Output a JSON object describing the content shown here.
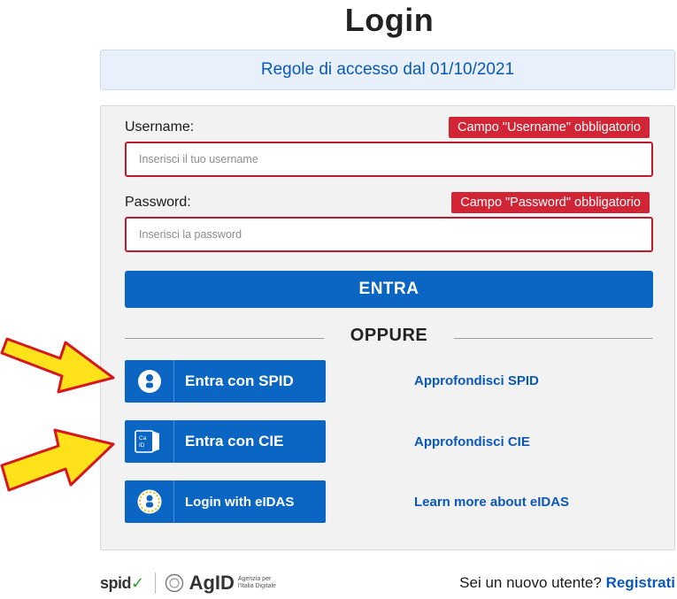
{
  "page": {
    "title": "Login"
  },
  "notice": {
    "text": "Regole di accesso dal 01/10/2021"
  },
  "form": {
    "username": {
      "label": "Username:",
      "error": "Campo \"Username\" obbligatorio",
      "placeholder": "Inserisci il tuo username",
      "value": ""
    },
    "password": {
      "label": "Password:",
      "error": "Campo \"Password\" obbligatorio",
      "placeholder": "Inserisci la password",
      "value": ""
    },
    "submit_label": "ENTRA",
    "divider_text": "OPPURE"
  },
  "auth_options": [
    {
      "label": "Entra con SPID",
      "icon": "user-circle-icon",
      "link": "Approfondisci SPID"
    },
    {
      "label": "Entra con CIE",
      "icon": "cie-card-icon",
      "cie_icon_text": "Ca\nID",
      "link": "Approfondisci CIE"
    },
    {
      "label": "Login with eIDAS",
      "icon": "eidas-icon",
      "link": "Learn more about eIDAS"
    }
  ],
  "footer": {
    "spid_logo": "spid",
    "agid_logo": "AgID",
    "agid_subtitle": "Agenzia per l'Italia Digitale",
    "register_prompt": "Sei un nuovo utente?",
    "register_link": "Registrati"
  },
  "colors": {
    "primary": "#0a66c2",
    "error": "#d12535",
    "link": "#0a58b8",
    "arrow_fill": "#ffe21a",
    "arrow_stroke": "#d6171c"
  }
}
